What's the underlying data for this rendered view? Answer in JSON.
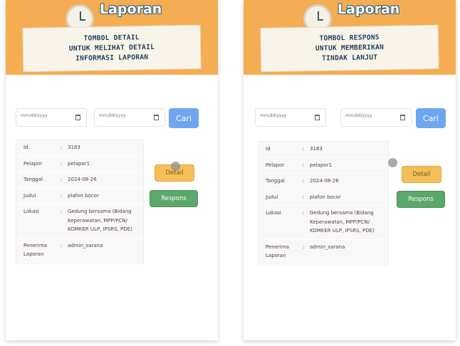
{
  "panels": [
    {
      "logo": "Laporan",
      "caption": "TOMBOL DETAIL\nUNTUK MELIHAT DETAIL\nINFORMASI LAPORAN",
      "filter": {
        "date_placeholder_1": "mm/dd/yyyy",
        "date_placeholder_2": "mm/dd/yyyy",
        "search_label": "Cari"
      },
      "report": {
        "id_label": "Id",
        "id_value": "3183",
        "pelapor_label": "Pelapor",
        "pelapor_value": "pelapor1",
        "tanggal_label": "Tanggal",
        "tanggal_value": "2024-08-26",
        "judul_label": "Judul",
        "judul_value": "plafon bocor",
        "lokasi_label": "Lokasi",
        "lokasi_value": "Gedung bersama (Bidang Keperawatan, MPP/PCN/ KOMKER ULP, IPSRS, PDE)",
        "penerima_label": "Penerima Laporan",
        "penerima_value": "admin_sarana",
        "separator": ":"
      },
      "actions": {
        "detail_label": "Detail",
        "respons_label": "Respons"
      }
    },
    {
      "logo": "Laporan",
      "caption": "TOMBOL RESPONS\nUNTUK MEMBERIKAN\nTINDAK LANJUT",
      "filter": {
        "date_placeholder_1": "mm/dd/yyyy",
        "date_placeholder_2": "mm/dd/yyyy",
        "search_label": "Cari"
      },
      "report": {
        "id_label": "Id",
        "id_value": "3183",
        "pelapor_label": "Pelapor",
        "pelapor_value": "pelapor1",
        "tanggal_label": "Tanggal",
        "tanggal_value": "2024-08-26",
        "judul_label": "Judul",
        "judul_value": "plafon bocor",
        "lokasi_label": "Lokasi",
        "lokasi_value": "Gedung bersama (Bidang Keperawatan, MPP/PCN/ KOMKER ULP, IPSRS, PDE)",
        "penerima_label": "Penerima Laporan",
        "penerima_value": "admin_sarana",
        "separator": ":"
      },
      "actions": {
        "detail_label": "Detail",
        "respons_label": "Respons"
      }
    }
  ],
  "colors": {
    "banner": "#f4ad53",
    "search_button": "#6fa7ef",
    "detail_button": "#f4bf58",
    "respons_button": "#5aa86a",
    "text": "#5a3a3a"
  },
  "icons": [
    "clock-icon",
    "calendar-icon"
  ]
}
